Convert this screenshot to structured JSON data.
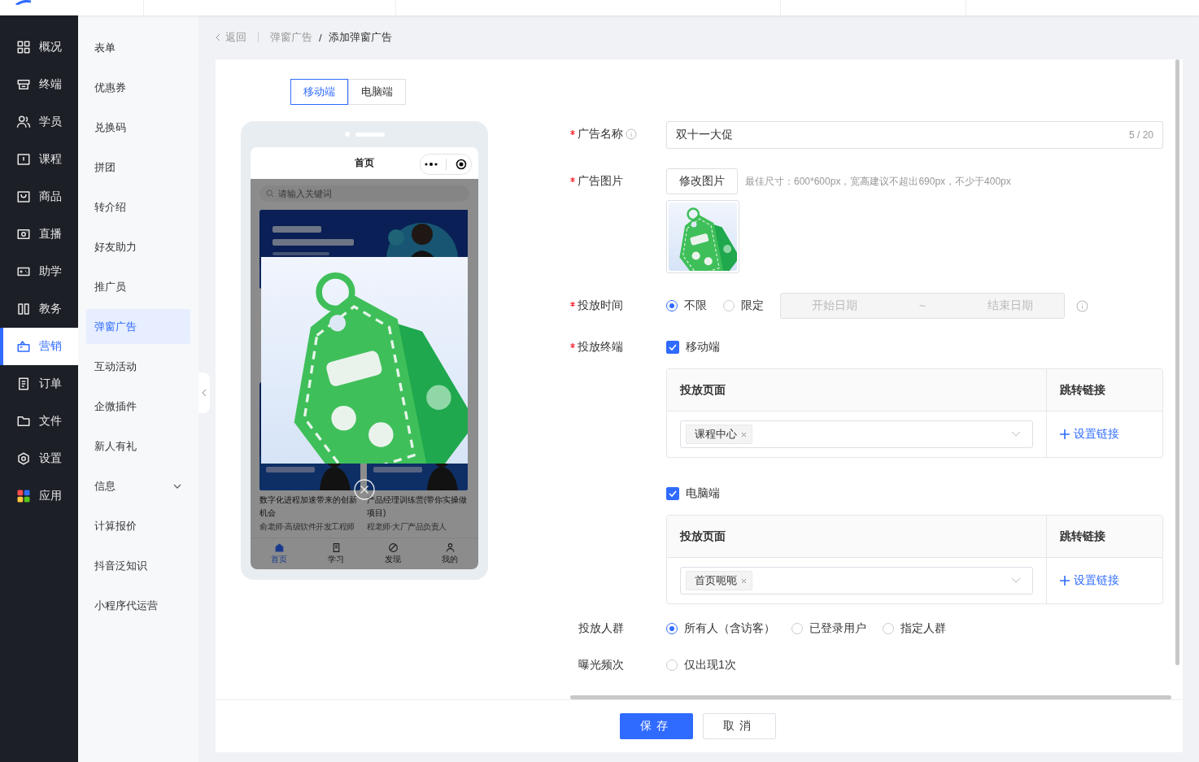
{
  "nav": [
    {
      "label": "概况",
      "selected": false
    },
    {
      "label": "终端",
      "selected": false
    },
    {
      "label": "学员",
      "selected": false
    },
    {
      "label": "课程",
      "selected": false
    },
    {
      "label": "商品",
      "selected": false
    },
    {
      "label": "直播",
      "selected": false
    },
    {
      "label": "助学",
      "selected": false
    },
    {
      "label": "教务",
      "selected": false
    },
    {
      "label": "营销",
      "selected": true
    },
    {
      "label": "订单",
      "selected": false
    },
    {
      "label": "文件",
      "selected": false
    },
    {
      "label": "设置",
      "selected": false
    },
    {
      "label": "应用",
      "selected": false
    }
  ],
  "subnav": [
    {
      "label": "表单",
      "selected": false
    },
    {
      "label": "优惠券",
      "selected": false
    },
    {
      "label": "兑换码",
      "selected": false
    },
    {
      "label": "拼团",
      "selected": false
    },
    {
      "label": "转介绍",
      "selected": false
    },
    {
      "label": "好友助力",
      "selected": false
    },
    {
      "label": "推广员",
      "selected": false
    },
    {
      "label": "弹窗广告",
      "selected": true
    },
    {
      "label": "互动活动",
      "selected": false
    },
    {
      "label": "企微插件",
      "selected": false
    },
    {
      "label": "新人有礼",
      "selected": false
    },
    {
      "label": "信息",
      "selected": false,
      "expanded": false
    },
    {
      "label": "计算报价",
      "selected": false
    },
    {
      "label": "抖音泛知识",
      "selected": false
    },
    {
      "label": "小程序代运营",
      "selected": false
    }
  ],
  "breadcrumb": {
    "back": "返回",
    "separator": "/",
    "items": [
      "弹窗广告",
      "添加弹窗广告"
    ]
  },
  "device_tabs": [
    {
      "label": "移动端",
      "selected": true
    },
    {
      "label": "电脑端",
      "selected": false
    }
  ],
  "preview": {
    "title": "首页",
    "search_placeholder": "请输入关键词",
    "cards": [
      {
        "title": "数字化进程加速带来的创新机会",
        "meta": "俞老师·高级软件开发工程师"
      },
      {
        "title": "产品经理训练营(带你实操做项目)",
        "meta": "程老师·大厂产品负责人"
      }
    ],
    "tabs": [
      {
        "label": "首页",
        "selected": true
      },
      {
        "label": "学习",
        "selected": false
      },
      {
        "label": "发现",
        "selected": false
      },
      {
        "label": "我的",
        "selected": false
      }
    ]
  },
  "form": {
    "name": {
      "label": "广告名称",
      "required": true,
      "value": "双十一大促",
      "counter": "5 / 20"
    },
    "image": {
      "label": "广告图片",
      "required": true,
      "button": "修改图片",
      "hint": "最佳尺寸：600*600px，宽高建议不超出690px，不少于400px"
    },
    "time": {
      "label": "投放时间",
      "required": true,
      "options": [
        {
          "label": "不限",
          "selected": true
        },
        {
          "label": "限定",
          "selected": false
        }
      ],
      "start_placeholder": "开始日期",
      "separator": "~",
      "end_placeholder": "结束日期"
    },
    "terminals": {
      "label": "投放终端",
      "required": true,
      "groups": [
        {
          "label": "移动端",
          "checked": true,
          "columns": [
            "投放页面",
            "跳转链接"
          ],
          "tag": "课程中心",
          "link": "设置链接"
        },
        {
          "label": "电脑端",
          "checked": true,
          "columns": [
            "投放页面",
            "跳转链接"
          ],
          "tag": "首页呃呃",
          "link": "设置链接"
        }
      ]
    },
    "audience": {
      "label": "投放人群",
      "required": false,
      "options": [
        {
          "label": "所有人（含访客）",
          "selected": true
        },
        {
          "label": "已登录用户",
          "selected": false
        },
        {
          "label": "指定人群",
          "selected": false
        }
      ]
    },
    "frequency": {
      "label": "曝光频次",
      "required": false,
      "options": [
        {
          "label": "仅出现1次",
          "selected": false
        }
      ]
    }
  },
  "footer": {
    "save": "保存",
    "cancel": "取消"
  }
}
